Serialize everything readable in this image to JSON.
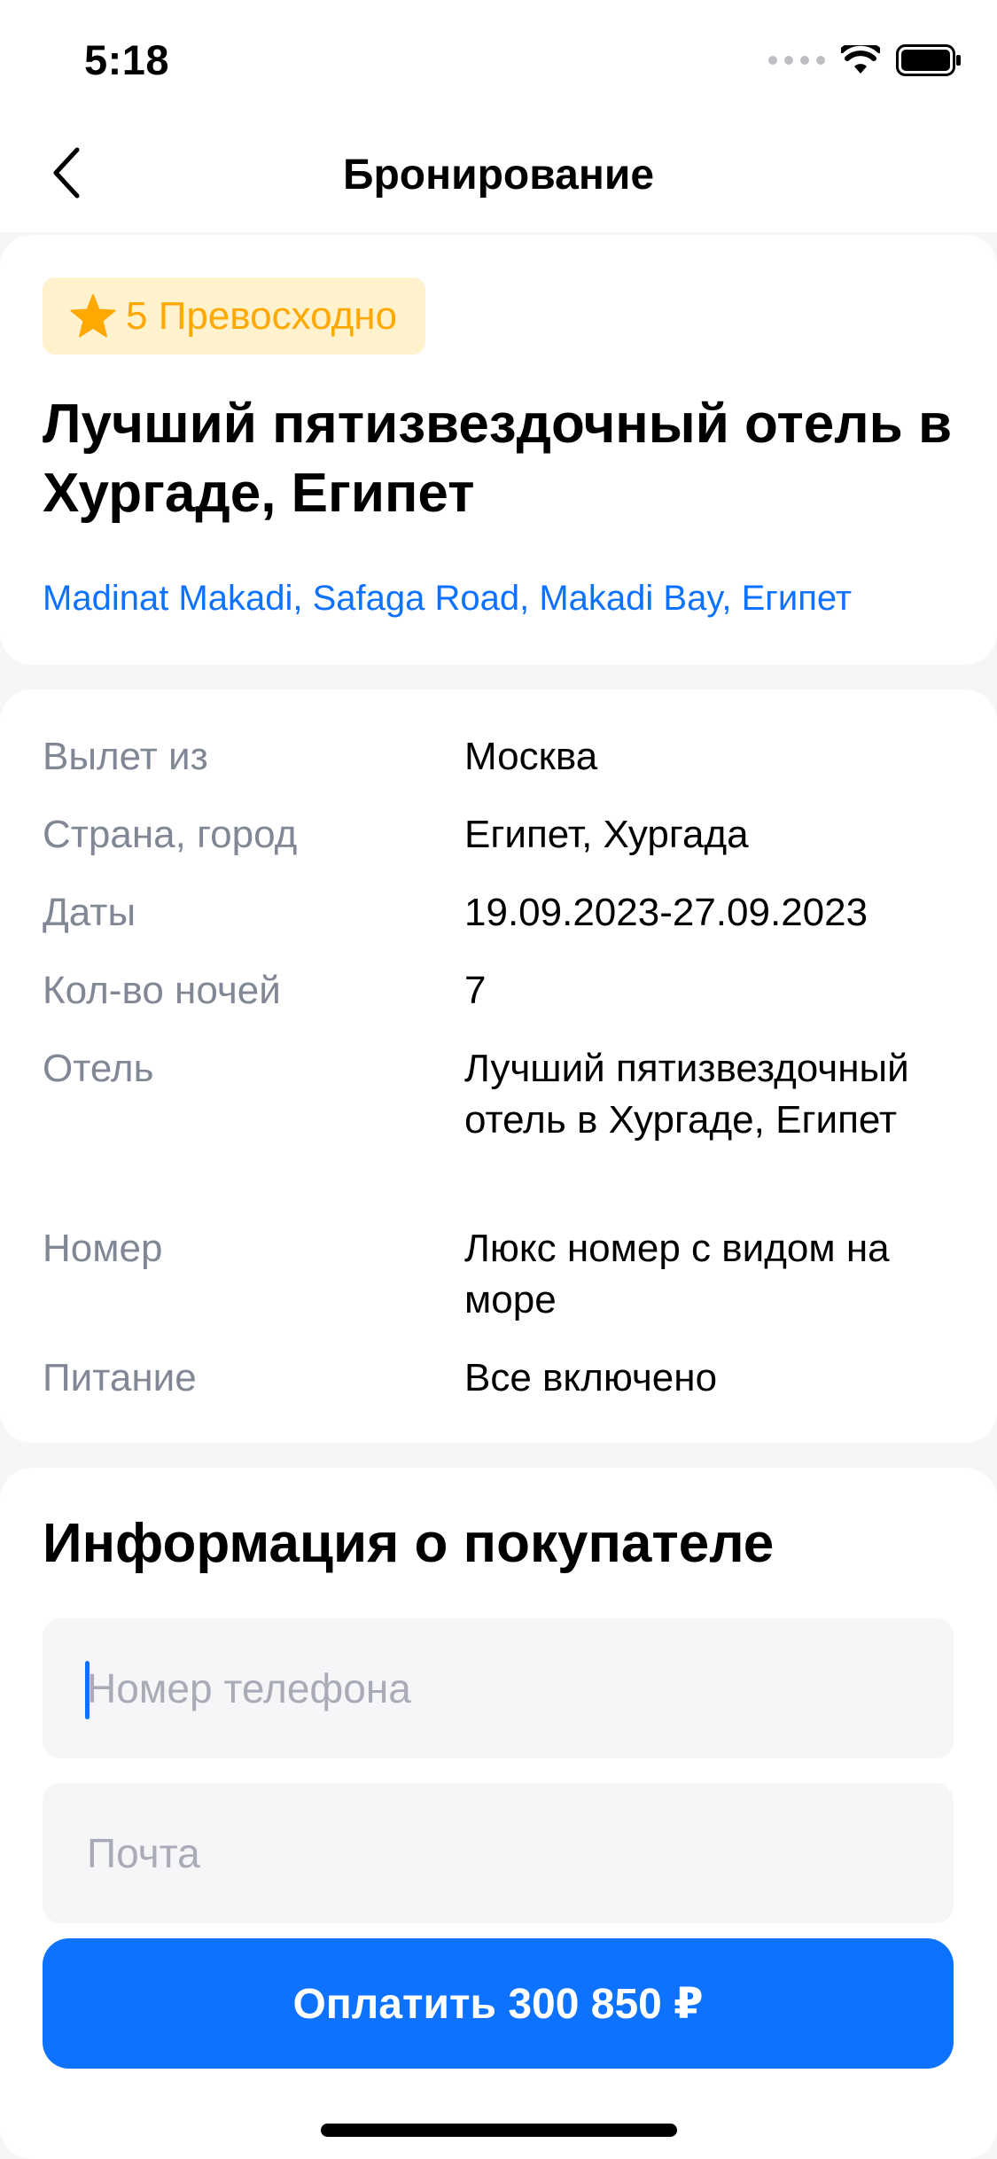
{
  "status_bar": {
    "time": "5:18"
  },
  "nav": {
    "title": "Бронирование",
    "back_icon": "chevron-left-icon"
  },
  "hotel": {
    "rating": "5 Превосходно",
    "rating_icon": "star-icon",
    "name": "Лучший пятизвездочный отель в Хургаде, Египет",
    "address": "Madinat Makadi, Safaga Road, Makadi Bay, Египет"
  },
  "details": [
    {
      "label": "Вылет из",
      "value": "Москва"
    },
    {
      "label": "Страна, город",
      "value": "Египет, Хургада"
    },
    {
      "label": "Даты",
      "value": "19.09.2023-27.09.2023"
    },
    {
      "label": "Кол-во ночей",
      "value": "7"
    },
    {
      "label": "Отель",
      "value": "Лучший пятизвездочный отель в Хургаде, Египет"
    },
    {
      "label": "Номер",
      "value": "Люкс номер с видом на море"
    },
    {
      "label": "Питание",
      "value": "Все включено"
    }
  ],
  "buyer": {
    "title": "Информация о покупателе",
    "phone_placeholder": "Номер телефона",
    "email_placeholder": "Почта"
  },
  "pay_button": {
    "label": "Оплатить 300 850 ₽"
  },
  "colors": {
    "accent": "#0D72FF",
    "rating_text": "#FFA800",
    "rating_bg": "#FFF2CC",
    "label_gray": "#828796",
    "page_bg": "#F6F6F9"
  }
}
